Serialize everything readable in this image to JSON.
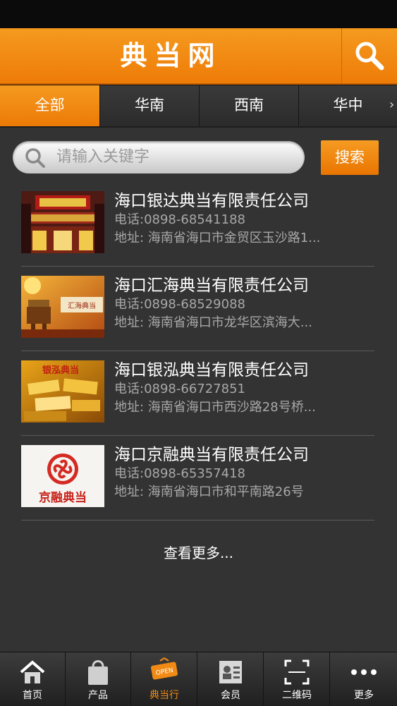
{
  "header": {
    "title": "典当网"
  },
  "tabs": [
    {
      "label": "全部",
      "active": true
    },
    {
      "label": "华南",
      "active": false
    },
    {
      "label": "西南",
      "active": false
    },
    {
      "label": "华中",
      "active": false
    }
  ],
  "tab_arrows": {
    "left": "‹",
    "right": "›"
  },
  "search": {
    "placeholder": "请输入关键字",
    "button_label": "搜索"
  },
  "listings": [
    {
      "name": "海口银达典当有限责任公司",
      "phone": "电话:0898-68541188",
      "address": "地址: 海南省海口市金贸区玉沙路1..."
    },
    {
      "name": "海口汇海典当有限责任公司",
      "phone": "电话:0898-68529088",
      "address": "地址: 海南省海口市龙华区滨海大..."
    },
    {
      "name": "海口银泓典当有限责任公司",
      "phone": "电话:0898-66727851",
      "address": "地址: 海南省海口市西沙路28号桥..."
    },
    {
      "name": "海口京融典当有限责任公司",
      "phone": "电话:0898-65357418",
      "address": "地址: 海南省海口市和平南路26号"
    }
  ],
  "thumb_text": {
    "jingrong": "京融典当",
    "huihai": "汇海典当",
    "yinhong": "银泓典当"
  },
  "more_label": "查看更多...",
  "bottom_nav": [
    {
      "label": "首页",
      "icon": "home-icon"
    },
    {
      "label": "产品",
      "icon": "bag-icon"
    },
    {
      "label": "典当行",
      "icon": "open-sign-icon",
      "active": true
    },
    {
      "label": "会员",
      "icon": "member-card-icon"
    },
    {
      "label": "二维码",
      "icon": "qr-scan-icon"
    },
    {
      "label": "更多",
      "icon": "more-dots-icon"
    }
  ],
  "colors": {
    "accent": "#f08a14",
    "background": "#333333",
    "muted_text": "#a8a8a8"
  }
}
